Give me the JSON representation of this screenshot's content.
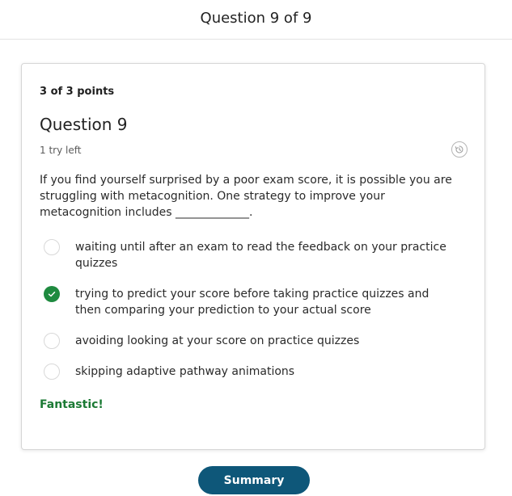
{
  "header": {
    "title": "Question 9 of 9"
  },
  "question": {
    "points": "3 of 3 points",
    "title": "Question 9",
    "tries_left": "1 try left",
    "prompt": "If you find yourself surprised by a poor exam score, it is possible you are struggling with metacognition. One strategy to improve your metacognition includes _____________.",
    "options": [
      {
        "label": "waiting until after an exam to read the feedback on your practice quizzes",
        "selected": false
      },
      {
        "label": "trying to predict your score before taking practice quizzes and then comparing your prediction to your actual score",
        "selected": true
      },
      {
        "label": "avoiding looking at your score on practice quizzes",
        "selected": false
      },
      {
        "label": "skipping adaptive pathway animations",
        "selected": false
      }
    ],
    "feedback": "Fantastic!"
  },
  "footer": {
    "summary_label": "Summary"
  },
  "colors": {
    "correct_green": "#1e8a3f",
    "feedback_green": "#1b7a34",
    "button_blue": "#0e5779"
  },
  "icons": {
    "history": "history-icon",
    "check": "checkmark-icon"
  }
}
